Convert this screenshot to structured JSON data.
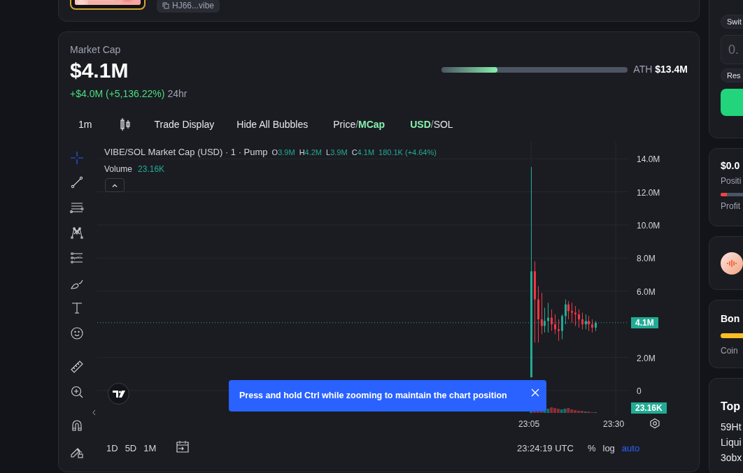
{
  "top_card": {
    "address": "HJ66...vibe"
  },
  "market_cap": {
    "label": "Market Cap",
    "value": "$4.1M",
    "change": "+$4.0M (+5,136.22%)",
    "period": "24hr",
    "ath_label": "ATH",
    "ath_value": "$13.4M",
    "ath_progress": {
      "level": 0.3
    }
  },
  "chart_toolbar": {
    "interval": "1m",
    "buttons": [
      "Trade Display",
      "Hide All Bubbles"
    ],
    "toggles": [
      {
        "separator": "/",
        "options": [
          {
            "label": "Price",
            "selected": false
          },
          {
            "label": "MCap",
            "selected": true
          }
        ]
      },
      {
        "separator": "/",
        "options": [
          {
            "label": "USD",
            "selected": true
          },
          {
            "label": "SOL",
            "selected": false
          }
        ]
      }
    ]
  },
  "chart": {
    "title": "VIBE/SOL Market Cap (USD) · 1 · Pump",
    "ohlc": [
      {
        "key": "O",
        "value": "3.9M"
      },
      {
        "key": "H",
        "value": "4.2M"
      },
      {
        "key": "L",
        "value": "3.9M"
      },
      {
        "key": "C",
        "value": "4.1M"
      }
    ],
    "change": "180.1K (+4.64%)",
    "volume_label": "Volume",
    "volume_value": "23.16K",
    "chart_data": {
      "type": "candlestick",
      "x": [
        1385,
        1386,
        1387,
        1388,
        1389,
        1390,
        1391,
        1392,
        1393,
        1394,
        1395,
        1396,
        1397,
        1398,
        1399,
        1400,
        1401,
        1402,
        1403,
        1404
      ],
      "ohlc": [
        [
          0.8,
          13.5,
          0.8,
          7.2
        ],
        [
          7.2,
          7.8,
          2.9,
          5.5
        ],
        [
          5.5,
          6.3,
          2.9,
          4.3
        ],
        [
          4.3,
          5.9,
          3.4,
          3.9
        ],
        [
          3.9,
          5.0,
          3.5,
          4.2
        ],
        [
          4.2,
          5.3,
          3.5,
          4.4
        ],
        [
          4.4,
          4.9,
          3.6,
          4.0
        ],
        [
          4.0,
          4.6,
          3.4,
          3.7
        ],
        [
          3.7,
          4.3,
          3.0,
          3.6
        ],
        [
          3.6,
          4.6,
          3.1,
          4.5
        ],
        [
          4.5,
          5.5,
          4.0,
          5.2
        ],
        [
          5.2,
          5.4,
          4.3,
          4.8
        ],
        [
          4.8,
          5.3,
          4.1,
          4.7
        ],
        [
          4.7,
          5.1,
          3.9,
          4.6
        ],
        [
          4.6,
          4.9,
          3.8,
          4.3
        ],
        [
          4.3,
          4.7,
          3.7,
          4.0
        ],
        [
          4.0,
          4.6,
          3.7,
          4.2
        ],
        [
          4.2,
          4.5,
          3.6,
          4.0
        ],
        [
          4.0,
          4.3,
          3.5,
          3.8
        ],
        [
          3.8,
          4.2,
          3.6,
          4.1
        ]
      ],
      "yticks": [
        {
          "value": 14,
          "label": "14.0M"
        },
        {
          "value": 12,
          "label": "12.0M"
        },
        {
          "value": 10,
          "label": "10.0M"
        },
        {
          "value": 8,
          "label": "8.0M"
        },
        {
          "value": 6,
          "label": "6.0M"
        },
        {
          "value": 2,
          "label": "2.0M"
        },
        {
          "value": 0,
          "label": "0"
        }
      ],
      "xticks": [
        {
          "value": 1385,
          "label": "23:05"
        },
        {
          "value": 1410,
          "label": "23:30"
        }
      ],
      "xlim": [
        1256.9,
        1413.9
      ],
      "ylim": [
        -1.52,
        15.02
      ],
      "grid": true,
      "ref_lines": [
        {
          "axis": "y",
          "value": 4.1,
          "label": "4.1M"
        }
      ]
    },
    "volume_tag": "23.16K",
    "ranges": [
      "1D",
      "5D",
      "1M"
    ],
    "clock": "23:24:19 UTC",
    "scale_buttons": [
      {
        "label": "%",
        "selected": false
      },
      {
        "label": "log",
        "selected": false
      },
      {
        "label": "auto",
        "selected": true
      }
    ],
    "toast": "Press and hold Ctrl while zooming to maintain the chart position"
  },
  "right_column": {
    "switch_button": "Swit",
    "amount_field": {
      "placeholder": "0."
    },
    "reset_button": "Res",
    "position_card": {
      "value": "$0.0",
      "label": "Positi",
      "progress": {
        "level": 0.05
      },
      "footer": "Profit"
    },
    "bonding_card": {
      "title": "Bon",
      "footer": "Coin"
    },
    "top_card": {
      "title": "Top",
      "rows": [
        "59Ht",
        "Liqui",
        "3obx"
      ]
    }
  }
}
